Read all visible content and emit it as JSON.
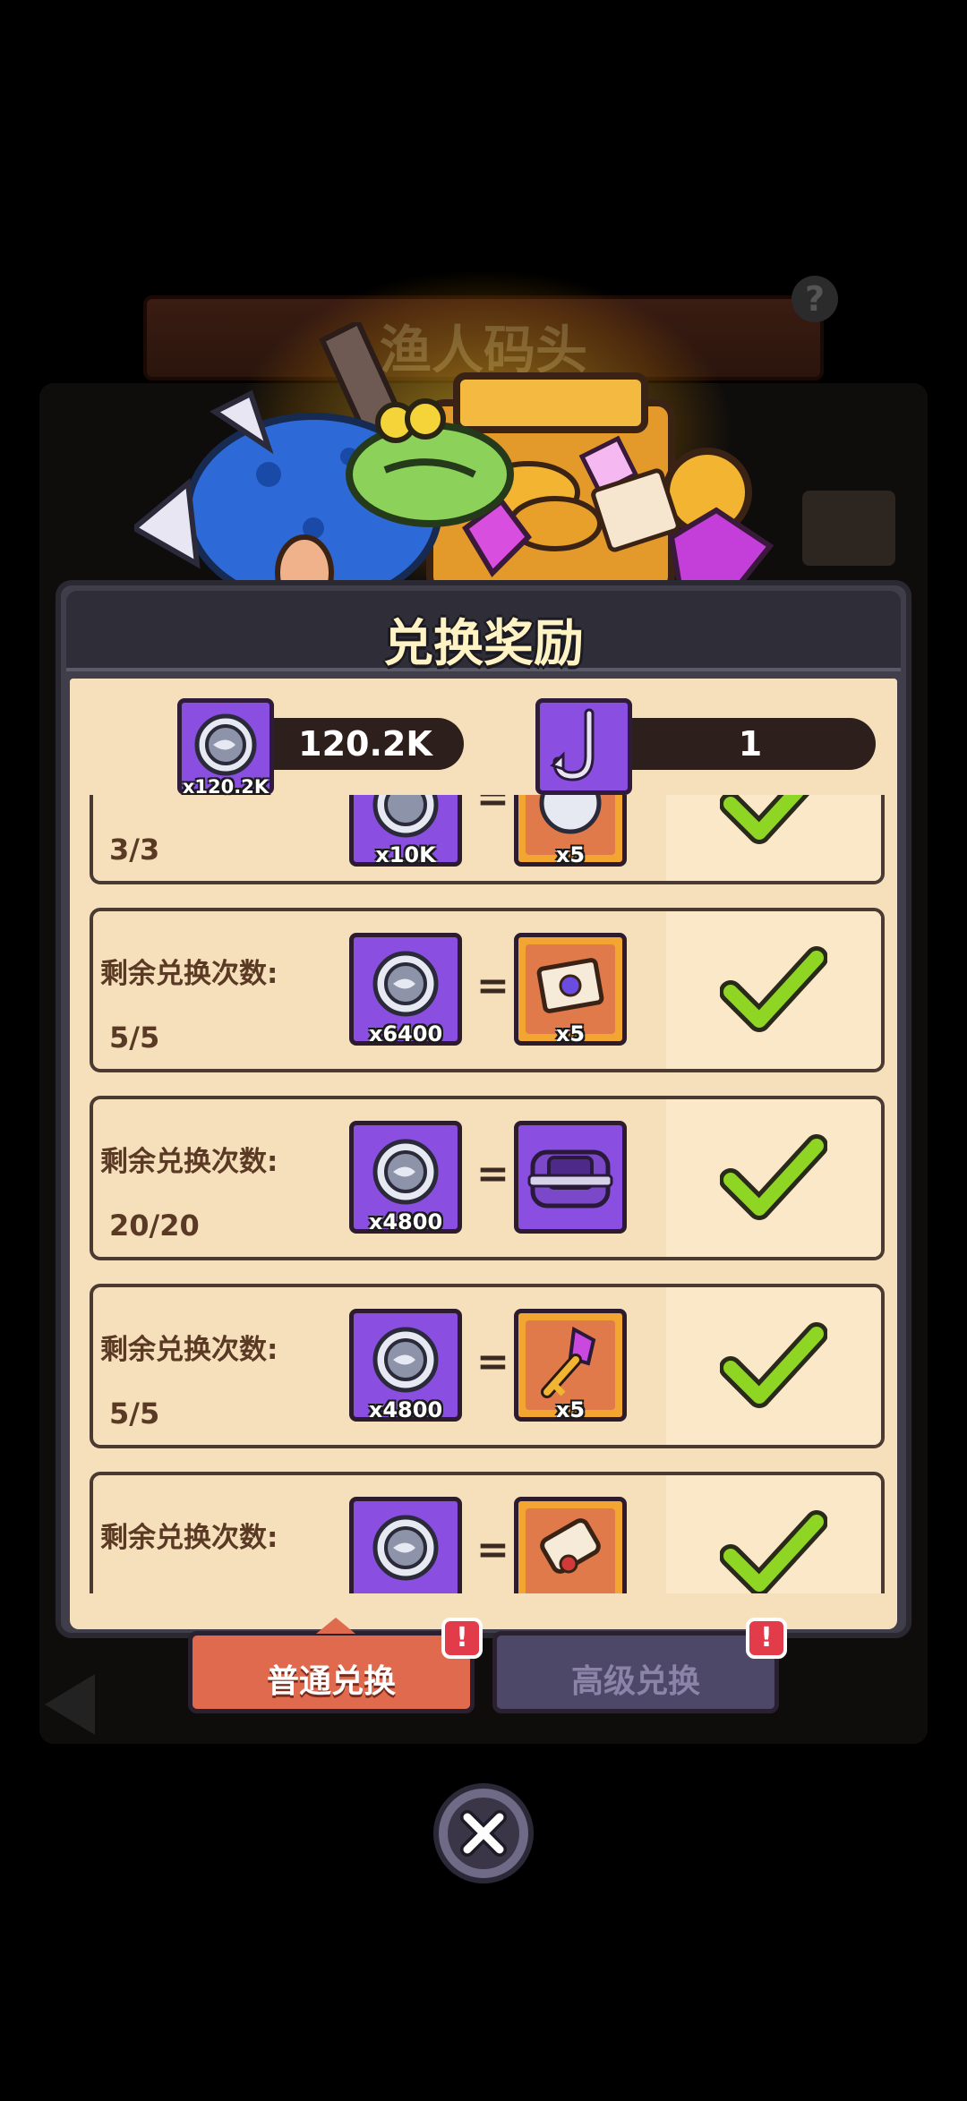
{
  "background": {
    "location_title": "渔人码头",
    "help_symbol": "?"
  },
  "modal": {
    "title": "兑换奖励"
  },
  "currencies": [
    {
      "icon": "fish-token-icon",
      "badge": "x120.2K",
      "value": "120.2K"
    },
    {
      "icon": "fishing-hook-icon",
      "value": "1"
    }
  ],
  "exchange_rows": [
    {
      "label": "",
      "remaining": "3/3",
      "cost": "x10K",
      "reward_qty": "x5",
      "reward_icon": "coin-token-icon",
      "status": "check-icon"
    },
    {
      "label": "剩余兑换次数:",
      "remaining": "5/5",
      "cost": "x6400",
      "reward_qty": "x5",
      "reward_icon": "envelope-icon",
      "status": "check-icon"
    },
    {
      "label": "剩余兑换次数:",
      "remaining": "20/20",
      "cost": "x4800",
      "reward_qty": "",
      "reward_icon": "purple-chest-icon",
      "status": "check-icon"
    },
    {
      "label": "剩余兑换次数:",
      "remaining": "5/5",
      "cost": "x4800",
      "reward_qty": "x5",
      "reward_icon": "key-icon",
      "status": "check-icon"
    },
    {
      "label": "剩余兑换次数:",
      "remaining": "",
      "cost": "",
      "reward_qty": "",
      "reward_icon": "scroll-icon",
      "status": "check-icon"
    }
  ],
  "equals_sign": "=",
  "tabs": [
    {
      "label": "普通兑换",
      "active": true,
      "badge": "!"
    },
    {
      "label": "高级兑换",
      "active": false,
      "badge": "!"
    }
  ],
  "colors": {
    "panel_bg": "#f6e0bc",
    "tile_purple": "#8a4ee0",
    "tile_orange": "#f2a531",
    "check_green": "#8fd624",
    "tab_active": "#e06a4e",
    "tab_inactive": "#4e4868",
    "badge_red": "#e23b4a"
  }
}
